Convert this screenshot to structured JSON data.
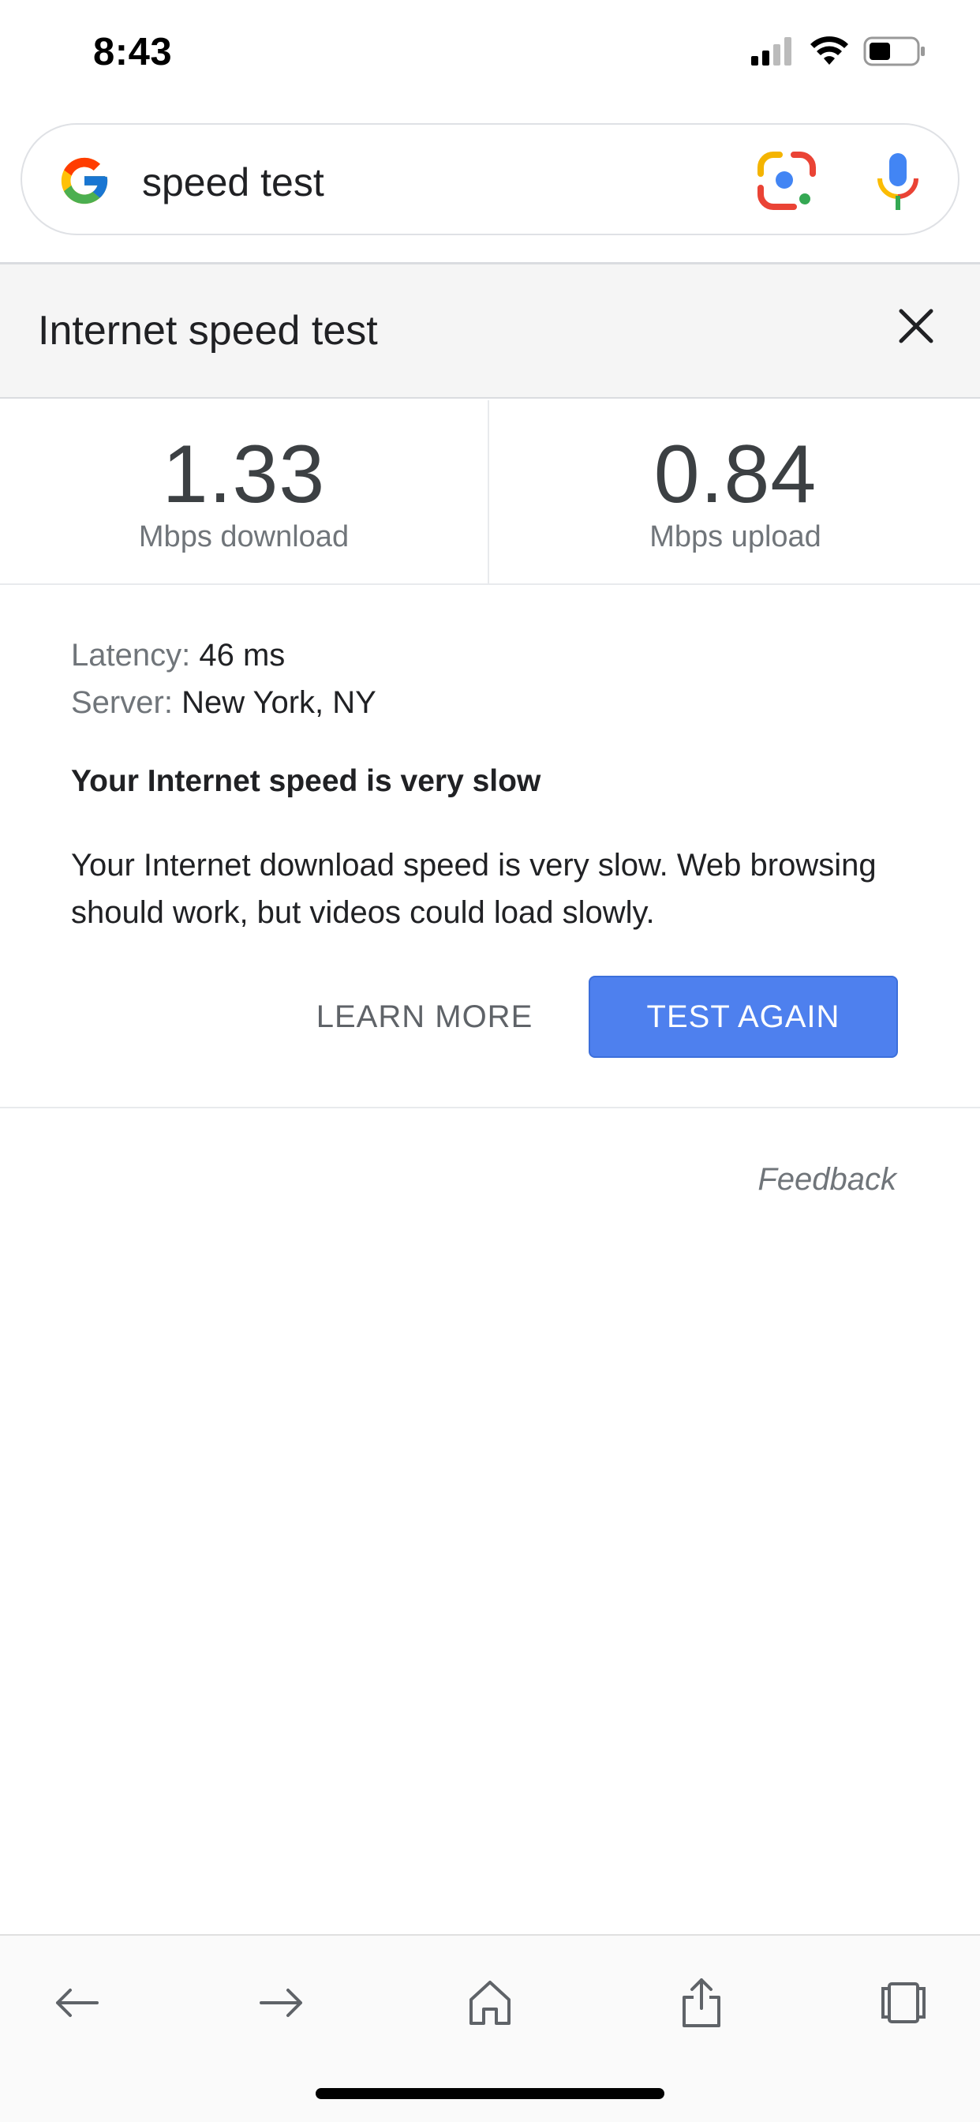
{
  "status_bar": {
    "time": "8:43",
    "icons": [
      "cellular-signal-icon",
      "wifi-icon",
      "battery-icon"
    ]
  },
  "search": {
    "query": "speed test",
    "icons": [
      "google-logo-icon",
      "google-lens-icon",
      "microphone-icon"
    ]
  },
  "widget": {
    "title": "Internet speed test",
    "download": {
      "value": "1.33",
      "unit": "Mbps download"
    },
    "upload": {
      "value": "0.84",
      "unit": "Mbps upload"
    },
    "latency": {
      "label": "Latency:",
      "value": "46 ms"
    },
    "server": {
      "label": "Server:",
      "value": "New York, NY"
    },
    "verdict": "Your Internet speed is very slow",
    "description": "Your Internet download speed is very slow. Web browsing should work, but videos could load slowly.",
    "learn_more_label": "LEARN MORE",
    "test_again_label": "TEST AGAIN",
    "feedback_label": "Feedback"
  },
  "toolbar": {
    "items": [
      "back-icon",
      "forward-icon",
      "home-icon",
      "share-icon",
      "tabs-icon"
    ]
  },
  "colors": {
    "accent": "#4e80ee",
    "header_bg": "#f5f5f5",
    "text": "#202124",
    "muted": "#70757a"
  }
}
